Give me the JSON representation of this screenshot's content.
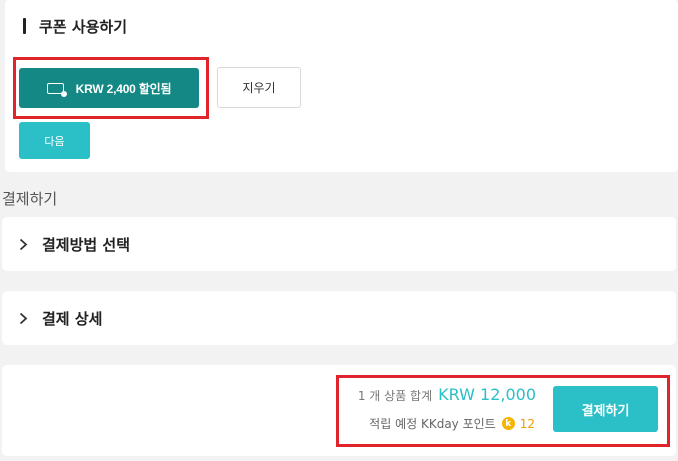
{
  "coupon": {
    "heading": "쿠폰 사용하기",
    "applied_label": "KRW 2,400 할인됨",
    "clear_label": "지우기",
    "next_label": "다음"
  },
  "payment": {
    "section_label": "결제하기",
    "method_label": "결제방법 선택",
    "detail_label": "결제 상세"
  },
  "summary": {
    "total_text": "1 개 상품 합계",
    "total_amount": "KRW 12,000",
    "points_text": "적립 예정 KKday 포인트",
    "points_icon": "k",
    "points_value": "12",
    "checkout_label": "결제하기"
  },
  "colors": {
    "primary_teal": "#148885",
    "accent_cyan": "#2bbfc7",
    "highlight_red": "#e0242b",
    "point_gold": "#f4b400"
  }
}
